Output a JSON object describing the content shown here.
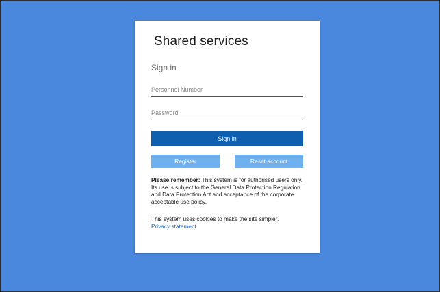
{
  "card": {
    "title": "Shared services",
    "subtitle": "Sign in"
  },
  "form": {
    "personnel_placeholder": "Personnel Number",
    "password_placeholder": "Password",
    "signin_label": "Sign in",
    "register_label": "Register",
    "reset_label": "Reset account"
  },
  "notice": {
    "bold_prefix": "Please remember:",
    "text": " This system is for authorised users only. Its use is subject to the General Data Protection Regulation and Data Protection Act and acceptance of the corporate acceptable use policy."
  },
  "cookies": {
    "text": "This system uses cookies to make the site simpler.",
    "privacy_link": "Privacy statement"
  },
  "colors": {
    "background": "#4a88dd",
    "primary_button": "#0f5fae",
    "secondary_button": "#6fb1ee",
    "link": "#1f63b8"
  }
}
